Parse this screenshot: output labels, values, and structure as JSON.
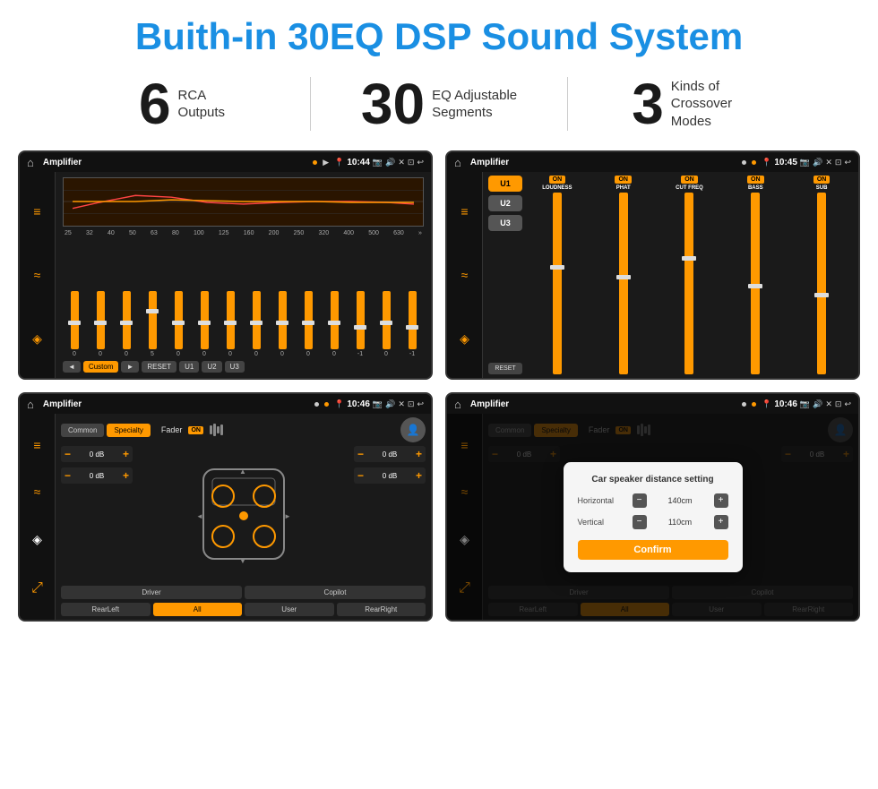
{
  "header": {
    "title": "Buith-in 30EQ DSP Sound System"
  },
  "stats": [
    {
      "number": "6",
      "text_line1": "RCA",
      "text_line2": "Outputs"
    },
    {
      "number": "30",
      "text_line1": "EQ Adjustable",
      "text_line2": "Segments"
    },
    {
      "number": "3",
      "text_line1": "Kinds of",
      "text_line2": "Crossover Modes"
    }
  ],
  "screens": {
    "screen1": {
      "title": "Amplifier",
      "time": "10:44",
      "eq_labels": [
        "25",
        "32",
        "40",
        "50",
        "63",
        "80",
        "100",
        "125",
        "160",
        "200",
        "250",
        "320",
        "400",
        "500",
        "630"
      ],
      "eq_values": [
        "0",
        "0",
        "0",
        "5",
        "0",
        "0",
        "0",
        "0",
        "0",
        "0",
        "0",
        "-1",
        "0",
        "-1"
      ],
      "buttons": [
        "Custom",
        "RESET",
        "U1",
        "U2",
        "U3"
      ],
      "active_button": "Custom"
    },
    "screen2": {
      "title": "Amplifier",
      "time": "10:45",
      "u_buttons": [
        "U1",
        "U2",
        "U3"
      ],
      "channels": [
        "LOUDNESS",
        "PHAT",
        "CUT FREQ",
        "BASS",
        "SUB"
      ],
      "reset": "RESET"
    },
    "screen3": {
      "title": "Amplifier",
      "time": "10:46",
      "mode_tabs": [
        "Common",
        "Specialty"
      ],
      "active_mode": "Specialty",
      "fader_label": "Fader",
      "fader_on": "ON",
      "speaker_btns": [
        "Driver",
        "Copilot",
        "RearLeft",
        "All",
        "User",
        "RearRight"
      ],
      "vol_labels": [
        "0 dB",
        "0 dB",
        "0 dB",
        "0 dB"
      ]
    },
    "screen4": {
      "title": "Amplifier",
      "time": "10:46",
      "mode_tabs": [
        "Common",
        "Specialty"
      ],
      "active_mode": "Specialty",
      "dialog": {
        "title": "Car speaker distance setting",
        "horizontal_label": "Horizontal",
        "horizontal_value": "140cm",
        "vertical_label": "Vertical",
        "vertical_value": "110cm",
        "confirm_label": "Confirm"
      },
      "vol_labels": [
        "0 dB",
        "0 dB"
      ],
      "speaker_btns": [
        "Driver",
        "Copilot",
        "RearLeft",
        "All",
        "User",
        "RearRight"
      ]
    }
  },
  "icons": {
    "home": "⌂",
    "back": "↩",
    "location": "📍",
    "camera": "📷",
    "volume": "🔊",
    "close": "✕",
    "window": "⊡",
    "eq_icon": "≡",
    "wave_icon": "≈",
    "speaker_icon": "◈",
    "arrow_left": "◄",
    "arrow_right": "►",
    "arrow_double_right": "»"
  }
}
